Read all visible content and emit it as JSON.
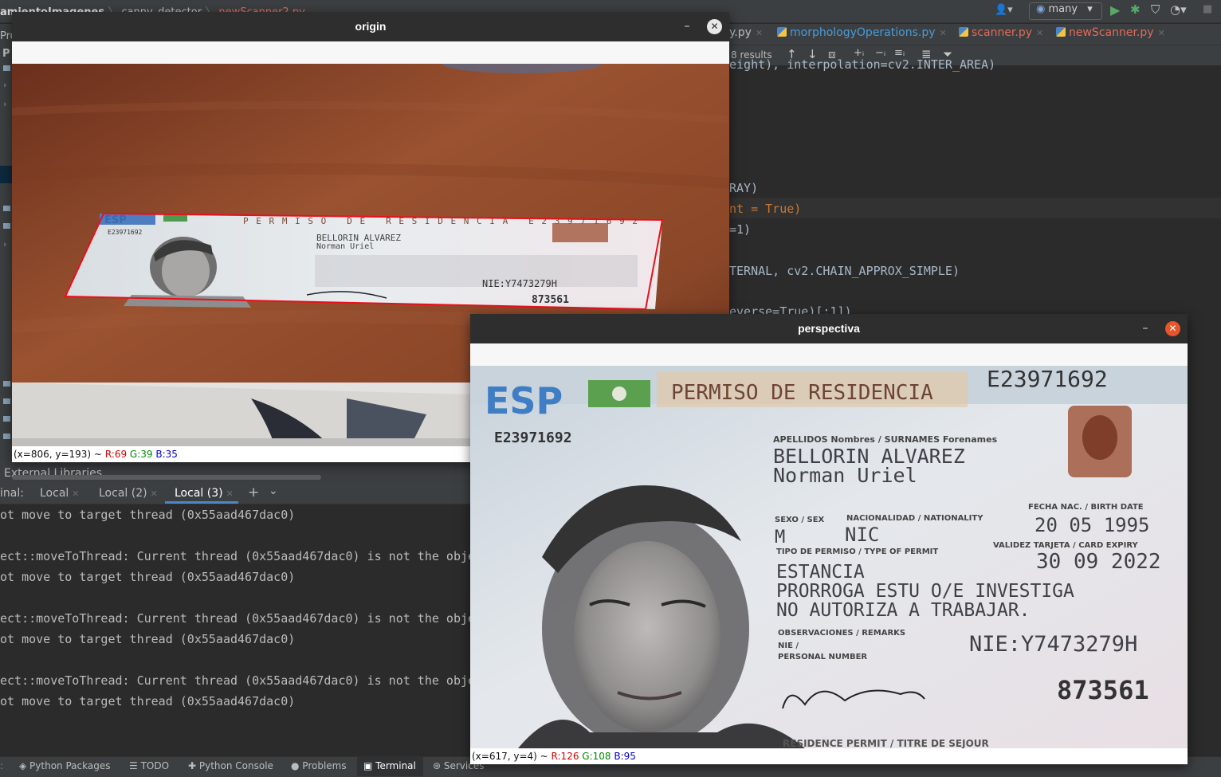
{
  "ide": {
    "breadcrumb": [
      "amientoImagenes",
      "canny_detector",
      "newScanner2.py"
    ],
    "run_config": "many",
    "editor_tabs": [
      {
        "label": "y.py"
      },
      {
        "label": "morphologyOperations.py"
      },
      {
        "label": "scanner.py"
      },
      {
        "label": "newScanner.py"
      }
    ],
    "find_results": "8 results",
    "code_lines": [
      {
        "text": "eight), interpolation=cv2.INTER_AREA)"
      },
      {
        "text": "RAY)"
      },
      {
        "text": "nt = True)"
      },
      {
        "text": "=1)"
      },
      {
        "text": "TERNAL, cv2.CHAIN_APPROX_SIMPLE)"
      },
      {
        "text": "everse=True)[:1])"
      }
    ],
    "external_libraries": "External Libraries",
    "terminal": {
      "label": "inal:",
      "tabs": [
        "Local",
        "Local (2)",
        "Local (3)"
      ],
      "add_label": "+",
      "lines": [
        "ot move to target thread (0x55aad467dac0)",
        "ect::moveToThread: Current thread (0x55aad467dac0) is not the obje",
        "ot move to target thread (0x55aad467dac0)",
        "ect::moveToThread: Current thread (0x55aad467dac0) is not the obje",
        "ot move to target thread (0x55aad467dac0)",
        "ect::moveToThread: Current thread (0x55aad467dac0) is not the obje",
        "ot move to target thread (0x55aad467dac0)"
      ]
    },
    "tool_windows": [
      "Python Packages",
      "TODO",
      "Python Console",
      "Problems",
      "Terminal",
      "Services"
    ]
  },
  "origin_window": {
    "title": "origin",
    "status_prefix": "(x=806, y=193) ~",
    "status_r": "R:69",
    "status_g": "G:39",
    "status_b": "B:35",
    "card": {
      "header": "PERMISO DE RESIDENCIA  E23971692",
      "esp": "ESP",
      "num": "E23971692",
      "surname": "BELLORIN ALVAREZ",
      "name": "Norman Uriel",
      "nie": "NIE:Y7473279H",
      "code": "873561"
    },
    "contour_color": "#e8101a"
  },
  "perspectiva_window": {
    "title": "perspectiva",
    "status_prefix": "(x=617, y=4) ~",
    "status_r": "R:126",
    "status_g": "G:108",
    "status_b": "B:95",
    "card": {
      "esp": "ESP",
      "header": "PERMISO DE RESIDENCIA",
      "id_top": "E23971692",
      "id_small": "E23971692",
      "names_label": "APELLIDOS Nombres / SURNAMES Forenames",
      "surname": "BELLORIN ALVAREZ",
      "forename": "Norman Uriel",
      "sex_label": "SEXO / SEX",
      "nat_label": "NACIONALIDAD / NATIONALITY",
      "birth_label": "FECHA NAC. / BIRTH DATE",
      "sex": "M",
      "nat": "NIC",
      "birth": "20 05 1995",
      "permit_label": "TIPO DE PERMISO / TYPE OF PERMIT",
      "valid_label": "VALIDEZ TARJETA / CARD EXPIRY",
      "expiry": "30 09 2022",
      "permit1": "ESTANCIA",
      "permit2": "PRORROGA ESTU O/E INVESTIGA",
      "permit3": "NO AUTORIZA A TRABAJAR.",
      "obs_label": "OBSERVACIONES / REMARKS",
      "nie_label": "NIE /",
      "pn_label": "PERSONAL NUMBER",
      "nie": "NIE:Y7473279H",
      "code": "873561",
      "footer": "RESIDENCE PERMIT / TITRE DE SEJOUR"
    }
  }
}
